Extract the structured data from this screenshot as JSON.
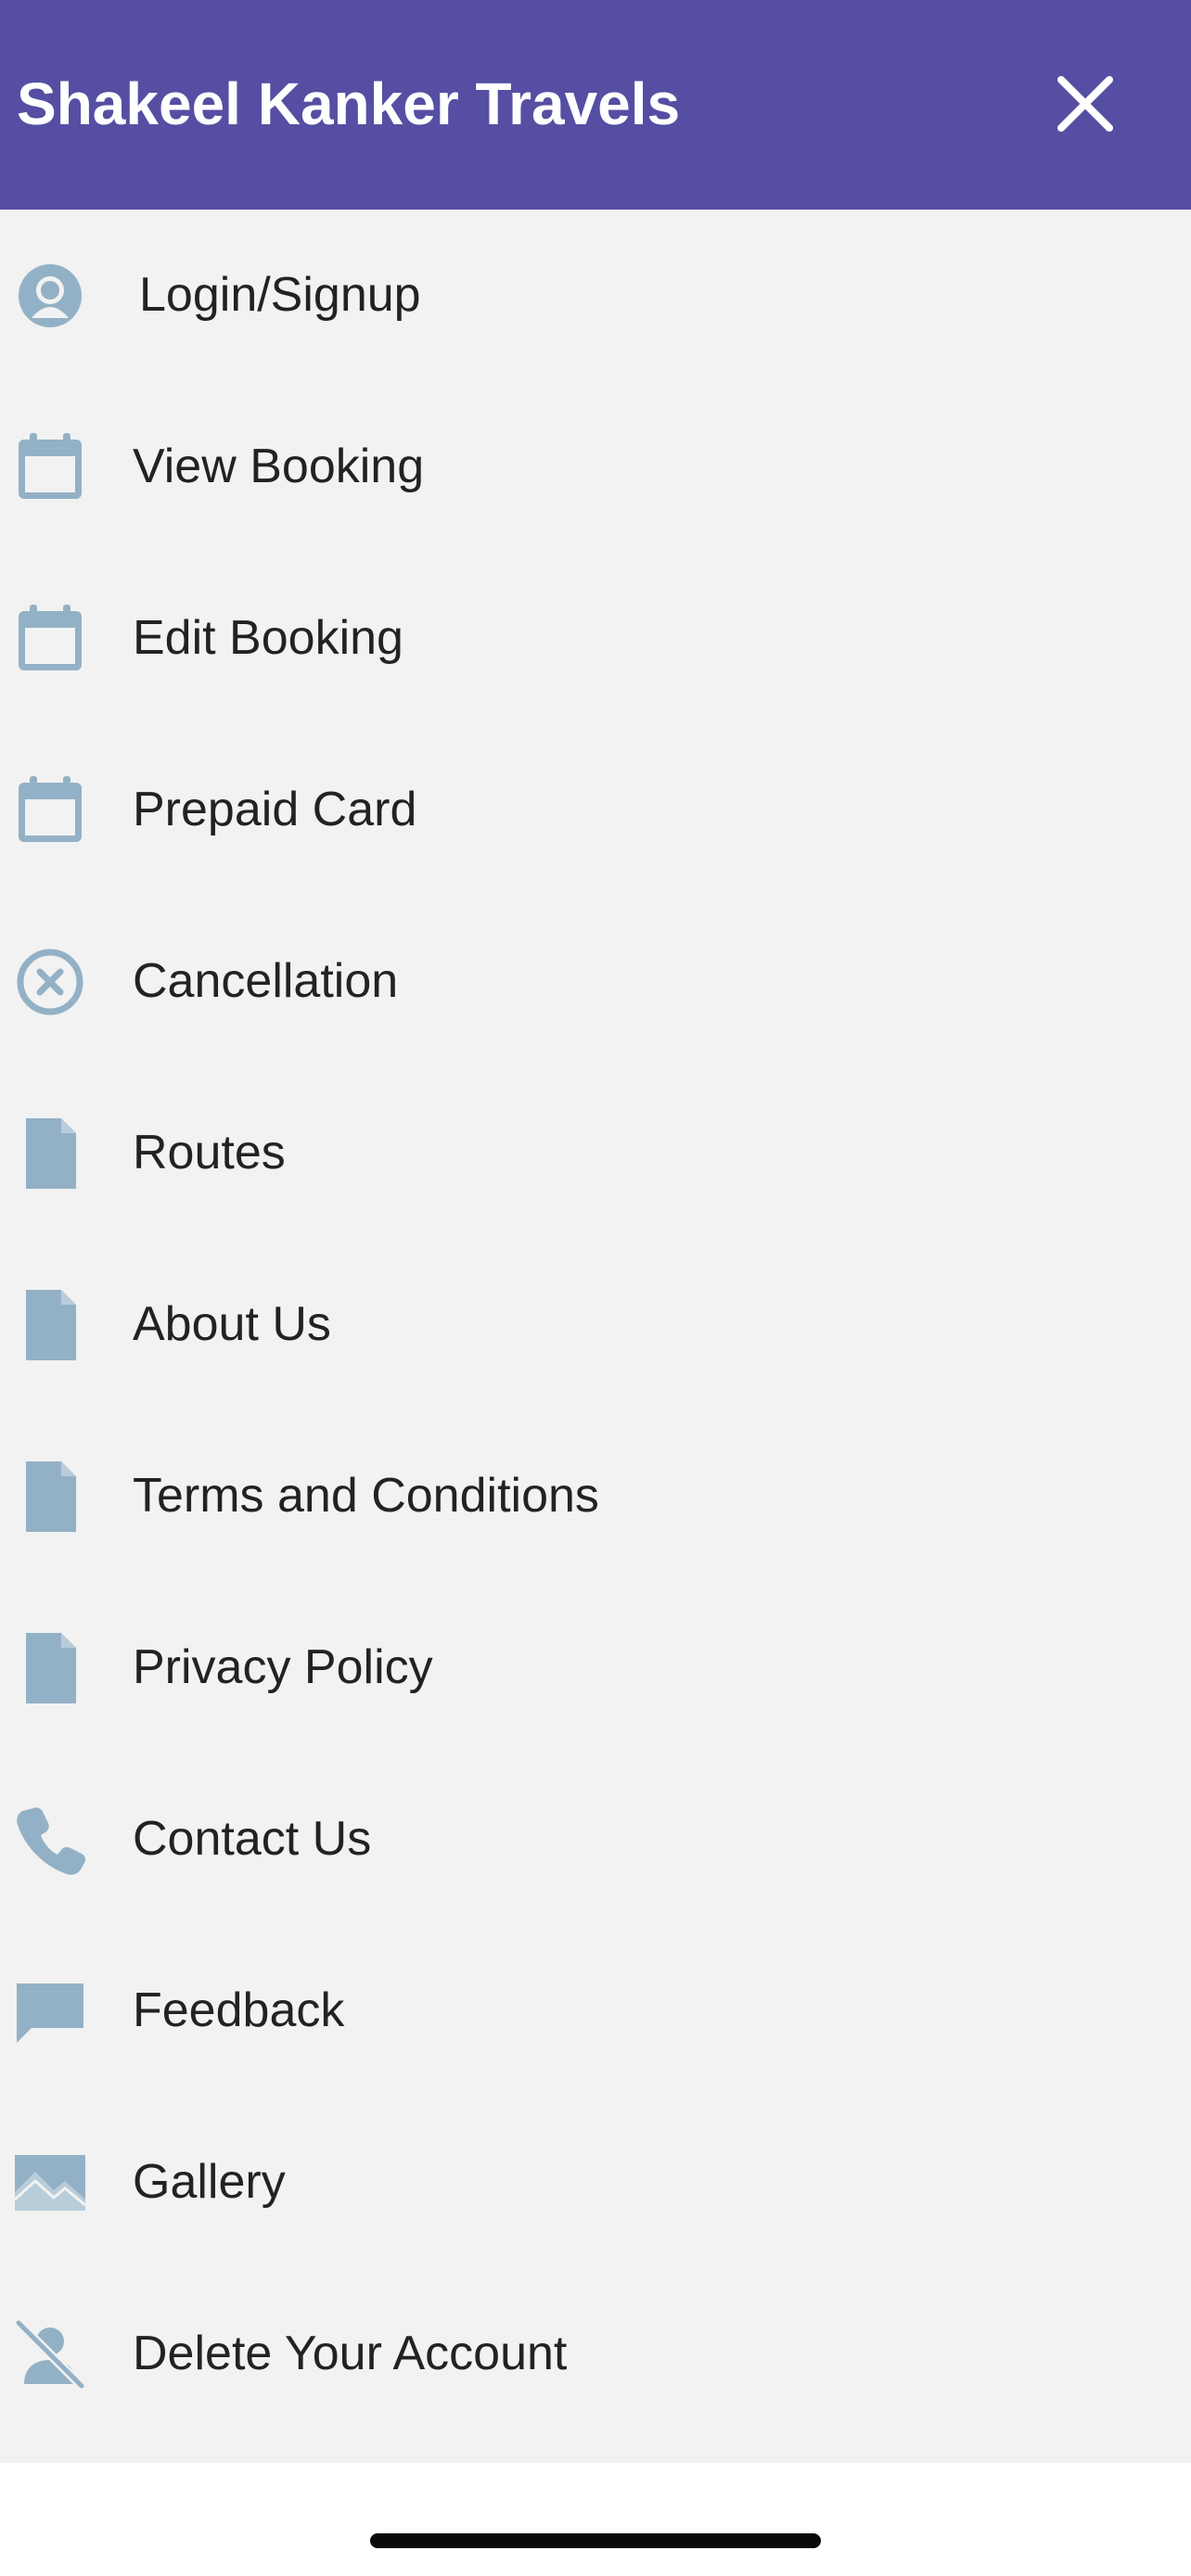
{
  "header": {
    "title": "Shakeel Kanker Travels",
    "close_icon": "close-icon"
  },
  "colors": {
    "header_bg": "#554ea2",
    "menu_bg": "#f2f2f2",
    "icon_color": "#93b1c6",
    "text_color": "#222222"
  },
  "menu": {
    "items": [
      {
        "label": "Login/Signup",
        "icon": "user-icon"
      },
      {
        "label": "View Booking",
        "icon": "calendar-icon"
      },
      {
        "label": "Edit Booking",
        "icon": "calendar-icon"
      },
      {
        "label": "Prepaid Card",
        "icon": "calendar-icon"
      },
      {
        "label": "Cancellation",
        "icon": "cancel-circle-icon"
      },
      {
        "label": "Routes",
        "icon": "document-icon"
      },
      {
        "label": "About Us",
        "icon": "document-icon"
      },
      {
        "label": "Terms and Conditions",
        "icon": "document-icon"
      },
      {
        "label": "Privacy Policy",
        "icon": "document-icon"
      },
      {
        "label": "Contact Us",
        "icon": "phone-icon"
      },
      {
        "label": "Feedback",
        "icon": "chat-bubble-icon"
      },
      {
        "label": "Gallery",
        "icon": "image-icon"
      },
      {
        "label": "Delete Your Account",
        "icon": "delete-user-icon"
      }
    ]
  }
}
